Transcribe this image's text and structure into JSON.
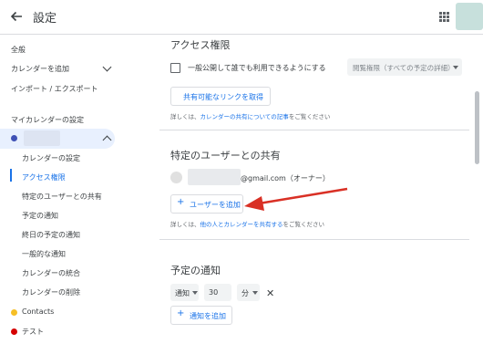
{
  "header": {
    "title": "設定",
    "back_icon": "arrow-back-icon",
    "apps_icon": "apps-grid-icon"
  },
  "sidebar": {
    "items": [
      {
        "label": "全般"
      },
      {
        "label": "カレンダーを追加"
      },
      {
        "label": "インポート / エクスポート"
      }
    ],
    "my_calendars_heading": "マイカレンダーの設定",
    "active_calendar_color": "#3f51b5",
    "sub_items": [
      {
        "label": "カレンダーの設定"
      },
      {
        "label": "アクセス権限"
      },
      {
        "label": "特定のユーザーとの共有"
      },
      {
        "label": "予定の通知"
      },
      {
        "label": "終日の予定の通知"
      },
      {
        "label": "一般的な通知"
      },
      {
        "label": "カレンダーの統合"
      },
      {
        "label": "カレンダーの削除"
      }
    ],
    "other_calendars": [
      {
        "label": "Contacts",
        "color": "#f6bf26"
      },
      {
        "label": "テスト",
        "color": "#d50000"
      }
    ]
  },
  "access": {
    "title": "アクセス権限",
    "public_checkbox_label": "一般公開して誰でも利用できるようにする",
    "permission_dropdown": "閲覧権限（すべての予定の詳細）",
    "share_link_button": "共有可能なリンクを取得",
    "help_prefix": "詳しくは、",
    "help_link": "カレンダーの共有についての記事",
    "help_suffix": "をご覧ください"
  },
  "sharing": {
    "title": "特定のユーザーとの共有",
    "user_email": "@gmail.com（オーナー）",
    "add_user_button": "ユーザーを追加",
    "help_prefix": "詳しくは、",
    "help_link": "他の人とカレンダーを共有する",
    "help_suffix": "をご覧ください"
  },
  "notifications": {
    "title": "予定の通知",
    "type": "通知",
    "amount": "30",
    "unit": "分",
    "add_button": "通知を追加"
  },
  "colors": {
    "accent": "#1a73e8",
    "annotation_arrow": "#d93025"
  }
}
